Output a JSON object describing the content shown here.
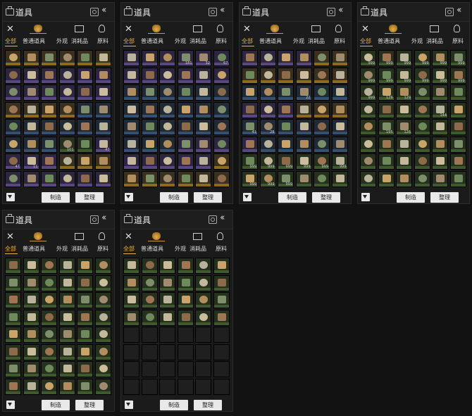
{
  "colors": {
    "accent": "#e9b44c",
    "background": "#121212",
    "panel": "#1b1b1b",
    "rarity_gold": "#8c6a22",
    "rarity_purple": "#5a4680",
    "rarity_blue": "#34506e",
    "rarity_green": "#3e5a2c",
    "rarity_empty": "#222222"
  },
  "panels": [
    {
      "title": "道具",
      "tabs": [
        "全部",
        "普通道具",
        "外观",
        "消耗品",
        "原料"
      ],
      "active_tab": 0,
      "buttons": {
        "craft": "制造",
        "sort": "整理"
      },
      "rows": [
        [
          "gold",
          "gold",
          "gold",
          "gold",
          "gold",
          "gold"
        ],
        [
          "purple",
          "purple",
          "purple",
          "purple",
          "purple",
          "purple"
        ],
        [
          "purple",
          "purple",
          "purple",
          "purple",
          "purple",
          "purple"
        ],
        [
          "gold",
          "gold",
          "gold",
          "gold",
          "blue",
          "blue"
        ],
        [
          "blue",
          "blue",
          "blue",
          "blue",
          "blue",
          "blue"
        ],
        [
          "blue",
          "blue",
          "blue",
          "green",
          "green",
          "purple"
        ],
        [
          "purple",
          "purple",
          "purple",
          "gold",
          "gold",
          "gold"
        ],
        [
          "purple",
          "purple",
          "purple",
          "purple",
          "purple",
          "purple"
        ]
      ],
      "counts": [
        "",
        "",
        "",
        "",
        "",
        "",
        "",
        "",
        "",
        "",
        "",
        "",
        "",
        "",
        "",
        "",
        "",
        "",
        "",
        "",
        "",
        "",
        "",
        "",
        "",
        "",
        "",
        "",
        "",
        "",
        "",
        "",
        "",
        "101",
        "",
        "47",
        "47",
        "11",
        "",
        "",
        "",
        "",
        "",
        "",
        "",
        "",
        "",
        ""
      ]
    },
    {
      "title": "道具",
      "tabs": [
        "全部",
        "普通道具",
        "外观",
        "消耗品",
        "原料"
      ],
      "active_tab": 0,
      "buttons": {
        "craft": "制造",
        "sort": "整理"
      },
      "rows": [
        [
          "purple",
          "purple",
          "purple",
          "purple",
          "purple",
          "purple"
        ],
        [
          "purple",
          "purple",
          "purple",
          "purple",
          "purple",
          "purple"
        ],
        [
          "blue",
          "blue",
          "blue",
          "blue",
          "blue",
          "blue"
        ],
        [
          "blue",
          "blue",
          "blue",
          "blue",
          "blue",
          "blue"
        ],
        [
          "blue",
          "blue",
          "blue",
          "blue",
          "blue",
          "blue"
        ],
        [
          "blue",
          "blue",
          "blue",
          "purple",
          "purple",
          "purple"
        ],
        [
          "purple",
          "purple",
          "purple",
          "purple",
          "purple",
          "gold"
        ],
        [
          "gold",
          "gold",
          "gold",
          "gold",
          "gold",
          "gold"
        ]
      ],
      "counts": [
        "",
        "",
        "",
        "181",
        "32",
        "67",
        "",
        "",
        "",
        "",
        "",
        "",
        "",
        "",
        "",
        "",
        "",
        "",
        "",
        "",
        "",
        "",
        "",
        "",
        "",
        "",
        "",
        "",
        "",
        "",
        "",
        "",
        "",
        "",
        "",
        "",
        "",
        "",
        "",
        "",
        "",
        "",
        "",
        "",
        "",
        "",
        "",
        ""
      ]
    },
    {
      "title": "道具",
      "tabs": [
        "全部",
        "普通道具",
        "外观",
        "消耗品",
        "原料"
      ],
      "active_tab": 0,
      "buttons": {
        "craft": "制造",
        "sort": "整理"
      },
      "rows": [
        [
          "purple",
          "purple",
          "purple",
          "purple",
          "gold",
          "gold"
        ],
        [
          "gold",
          "gold",
          "gold",
          "gold",
          "gold",
          "gold"
        ],
        [
          "blue",
          "blue",
          "blue",
          "blue",
          "blue",
          "blue"
        ],
        [
          "purple",
          "purple",
          "purple",
          "gold",
          "gold",
          "gold"
        ],
        [
          "blue",
          "blue",
          "blue",
          "blue",
          "blue",
          "blue"
        ],
        [
          "purple",
          "blue",
          "blue",
          "blue",
          "blue",
          "blue"
        ],
        [
          "green",
          "green",
          "green",
          "green",
          "green",
          "green"
        ],
        [
          "green",
          "green",
          "green",
          "green",
          "green",
          "green"
        ]
      ],
      "counts": [
        "",
        "",
        "",
        "",
        "",
        "",
        "",
        "",
        "",
        "",
        "",
        "",
        "",
        "",
        "",
        "22",
        "",
        "",
        "",
        "",
        "",
        "",
        "",
        "",
        "41",
        "28",
        "",
        "",
        "",
        "",
        "",
        "",
        "",
        "",
        "",
        "",
        "999",
        "999",
        "999",
        "999",
        "999",
        "999",
        "999",
        "999",
        "999",
        "",
        "",
        ""
      ]
    },
    {
      "title": "道具",
      "tabs": [
        "全部",
        "普通道具",
        "外观",
        "消耗品",
        "原料"
      ],
      "active_tab": 0,
      "buttons": {
        "craft": "制造",
        "sort": "整理"
      },
      "rows": [
        [
          "green",
          "green",
          "green",
          "green",
          "green",
          "green"
        ],
        [
          "green",
          "green",
          "green",
          "green",
          "green",
          "green"
        ],
        [
          "green",
          "green",
          "green",
          "green",
          "green",
          "green"
        ],
        [
          "green",
          "green",
          "green",
          "green",
          "green",
          "green"
        ],
        [
          "green",
          "green",
          "green",
          "green",
          "green",
          "green"
        ],
        [
          "green",
          "green",
          "green",
          "green",
          "green",
          "green"
        ],
        [
          "green",
          "green",
          "green",
          "green",
          "green",
          "green"
        ],
        [
          "green",
          "green",
          "green",
          "green",
          "green",
          "green"
        ]
      ],
      "counts": [
        "999",
        "999",
        "999",
        "999",
        "999",
        "999",
        "999",
        "999",
        "999",
        "999",
        "999",
        "999",
        "999",
        "129",
        "129",
        "",
        "",
        "",
        "",
        "",
        "",
        "",
        "144",
        "",
        "",
        "195",
        "126",
        "",
        "",
        "",
        "",
        "",
        "",
        "",
        "",
        ""
      ]
    },
    {
      "title": "道具",
      "tabs": [
        "全部",
        "普通道具",
        "外观",
        "消耗品",
        "原料"
      ],
      "active_tab": 0,
      "buttons": {
        "craft": "制造",
        "sort": "整理"
      },
      "rows": [
        [
          "green",
          "green",
          "green",
          "green",
          "green",
          "green"
        ],
        [
          "green",
          "green",
          "green",
          "green",
          "green",
          "green"
        ],
        [
          "green",
          "green",
          "green",
          "green",
          "green",
          "green"
        ],
        [
          "green",
          "green",
          "green",
          "green",
          "green",
          "green"
        ],
        [
          "green",
          "green",
          "green",
          "green",
          "green",
          "green"
        ],
        [
          "green",
          "green",
          "green",
          "green",
          "green",
          "green"
        ],
        [
          "green",
          "green",
          "green",
          "green",
          "green",
          "green"
        ],
        [
          "green",
          "green",
          "green",
          "green",
          "green",
          "green"
        ]
      ],
      "counts": [
        "",
        "",
        "",
        "",
        "",
        "",
        "",
        "",
        "",
        "",
        "",
        "",
        "",
        "",
        "",
        "",
        "",
        "",
        "",
        "",
        "",
        "",
        "",
        "",
        "",
        "",
        "",
        "",
        "",
        "",
        "",
        "",
        "",
        "",
        "",
        "",
        "",
        "",
        "",
        "",
        "",
        "",
        "",
        "",
        "",
        "",
        "",
        ""
      ]
    },
    {
      "title": "道具",
      "tabs": [
        "全部",
        "普通道具",
        "外观",
        "消耗品",
        "原料"
      ],
      "active_tab": 0,
      "buttons": {
        "craft": "制造",
        "sort": "整理"
      },
      "rows": [
        [
          "green",
          "green",
          "green",
          "green",
          "green",
          "green"
        ],
        [
          "green",
          "green",
          "green",
          "green",
          "green",
          "green"
        ],
        [
          "green",
          "green",
          "green",
          "green",
          "green",
          "green"
        ],
        [
          "green",
          "green",
          "green",
          "green",
          "green",
          "green"
        ],
        [
          "empty",
          "empty",
          "empty",
          "empty",
          "empty",
          "empty"
        ],
        [
          "empty",
          "empty",
          "empty",
          "empty",
          "empty",
          "empty"
        ],
        [
          "empty",
          "empty",
          "empty",
          "empty",
          "empty",
          "empty"
        ],
        [
          "empty",
          "empty",
          "empty",
          "empty",
          "empty",
          "empty"
        ]
      ],
      "counts": [
        "",
        "",
        "",
        "",
        "",
        "",
        "",
        "",
        "",
        "",
        "",
        "",
        "",
        "",
        "",
        "",
        "",
        "",
        "",
        "",
        "",
        "",
        "",
        "",
        "",
        "",
        "",
        "",
        "",
        "",
        "",
        "",
        "",
        "",
        "",
        "",
        "",
        "",
        "",
        "",
        "",
        "",
        "",
        "",
        "",
        "",
        "",
        ""
      ]
    }
  ]
}
